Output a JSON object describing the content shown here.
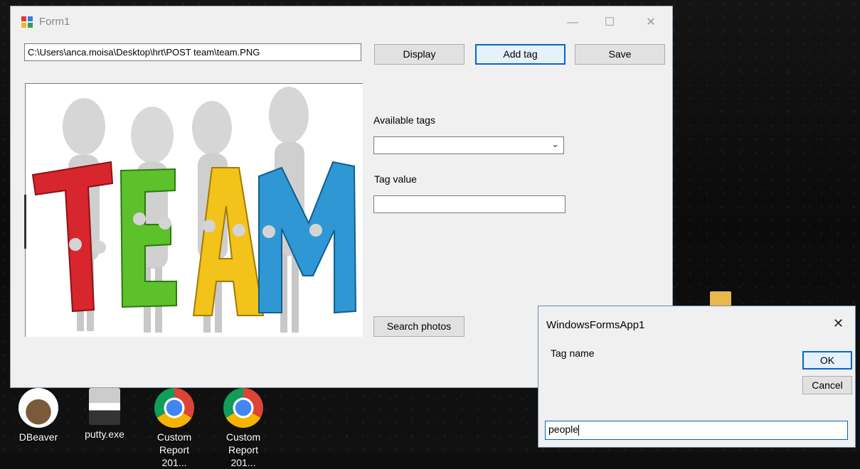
{
  "desktop": {
    "icons": [
      {
        "label": "DBeaver",
        "icon": "dbeaver-icon"
      },
      {
        "label": "putty.exe",
        "icon": "putty-icon"
      },
      {
        "label": "Custom Report 201...",
        "icon": "chrome-icon"
      },
      {
        "label": "Custom Report 201...",
        "icon": "chrome-icon"
      }
    ]
  },
  "form1": {
    "title": "Form1",
    "window_controls": {
      "minimize": "—",
      "maximize": "☐",
      "close": "✕"
    },
    "path_value": "C:\\Users\\anca.moisa\\Desktop\\hrt\\POST team\\team.PNG",
    "buttons": {
      "display": "Display",
      "add_tag": "Add tag",
      "save": "Save",
      "search": "Search photos"
    },
    "available_tags_label": "Available tags",
    "available_tags_selected": "",
    "tag_value_label": "Tag value",
    "tag_value": "",
    "picture": {
      "letters": [
        "T",
        "E",
        "A",
        "M"
      ],
      "colors": [
        "#d8262e",
        "#5cc12a",
        "#f3c21b",
        "#2f97d4"
      ]
    }
  },
  "dialog": {
    "title": "WindowsFormsApp1",
    "close": "✕",
    "prompt": "Tag name",
    "ok": "OK",
    "cancel": "Cancel",
    "input_value": "people"
  }
}
